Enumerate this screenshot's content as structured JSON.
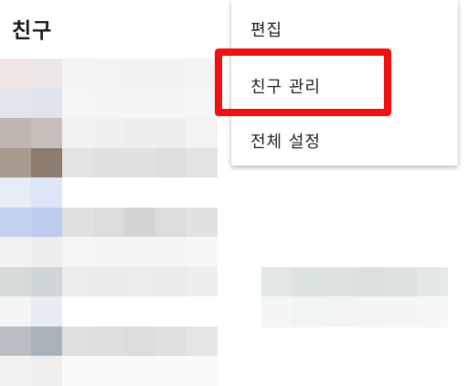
{
  "header": {
    "title": "친구"
  },
  "menu": {
    "items": [
      {
        "id": "edit",
        "label": "편집"
      },
      {
        "id": "manage",
        "label": "친구 관리"
      },
      {
        "id": "settings",
        "label": "전체 설정"
      }
    ]
  },
  "highlight": {
    "color": "#ee1111",
    "target": "친구 관리"
  },
  "friend_list": {
    "rows": [
      [
        "#f1e5e6",
        "#ece8ea",
        "#f4f4f4",
        "#f3f3f3",
        "#f2f2f2",
        "#f2f2f2",
        "#f4f4f4"
      ],
      [
        "#e3e6ee",
        "#e0e3ec",
        "#f6f6f6",
        "#f4f4f4",
        "#f5f5f5",
        "#f5f5f5",
        "#f6f6f6"
      ],
      [
        "#bfb8b2",
        "#c6bfba",
        "#f2f2f2",
        "#f0f0f0",
        "#eeeeee",
        "#eeeeee",
        "#f3f3f3"
      ],
      [
        "#a79a8f",
        "#8d7c70",
        "#e4e4e4",
        "#e1e1e1",
        "#e2e2e2",
        "#dedede",
        "#e3e3e3"
      ],
      [
        "#e7ecf6",
        "#dde5f8",
        "#ffffff",
        "#ffffff",
        "#ffffff",
        "#ffffff",
        "#ffffff"
      ],
      [
        "#c3d0ee",
        "#bdcbee",
        "#e1e1e1",
        "#dcdcdc",
        "#d4d4d4",
        "#dcdcdc",
        "#e2e2e2"
      ],
      [
        "#f2f2f2",
        "#eeeeee",
        "#f6f6f6",
        "#f5f5f5",
        "#f5f5f5",
        "#f4f4f4",
        "#f6f6f6"
      ],
      [
        "#d5dbdb",
        "#cfd6da",
        "#ececec",
        "#ebebeb",
        "#ececec",
        "#ebebeb",
        "#eeeeee"
      ],
      [
        "#f3f4f6",
        "#e6ecf1",
        "#ffffff",
        "#ffffff",
        "#ffffff",
        "#ffffff",
        "#ffffff"
      ],
      [
        "#b8bec4",
        "#aab2ba",
        "#e0e0e0",
        "#dedede",
        "#dcdcdc",
        "#e0e0e0",
        "#e5e5e5"
      ],
      [
        "#f1f1f1",
        "#efefef",
        "#fafafa",
        "#fafafa",
        "#fafafa",
        "#fafafa",
        "#fafafa"
      ]
    ],
    "right_bars": [
      {
        "row": 7,
        "colors": [
          "#e1e8e4",
          "#dce4df",
          "#dde4e0",
          "#dbe2de",
          "#dde4e0",
          "#e3eae6"
        ]
      },
      {
        "row": 8,
        "colors": [
          "#f3f6f5",
          "#f0f4f2",
          "#f1f4f3",
          "#f2f5f4",
          "#f4f6f5",
          "#f6f8f7"
        ]
      }
    ]
  }
}
